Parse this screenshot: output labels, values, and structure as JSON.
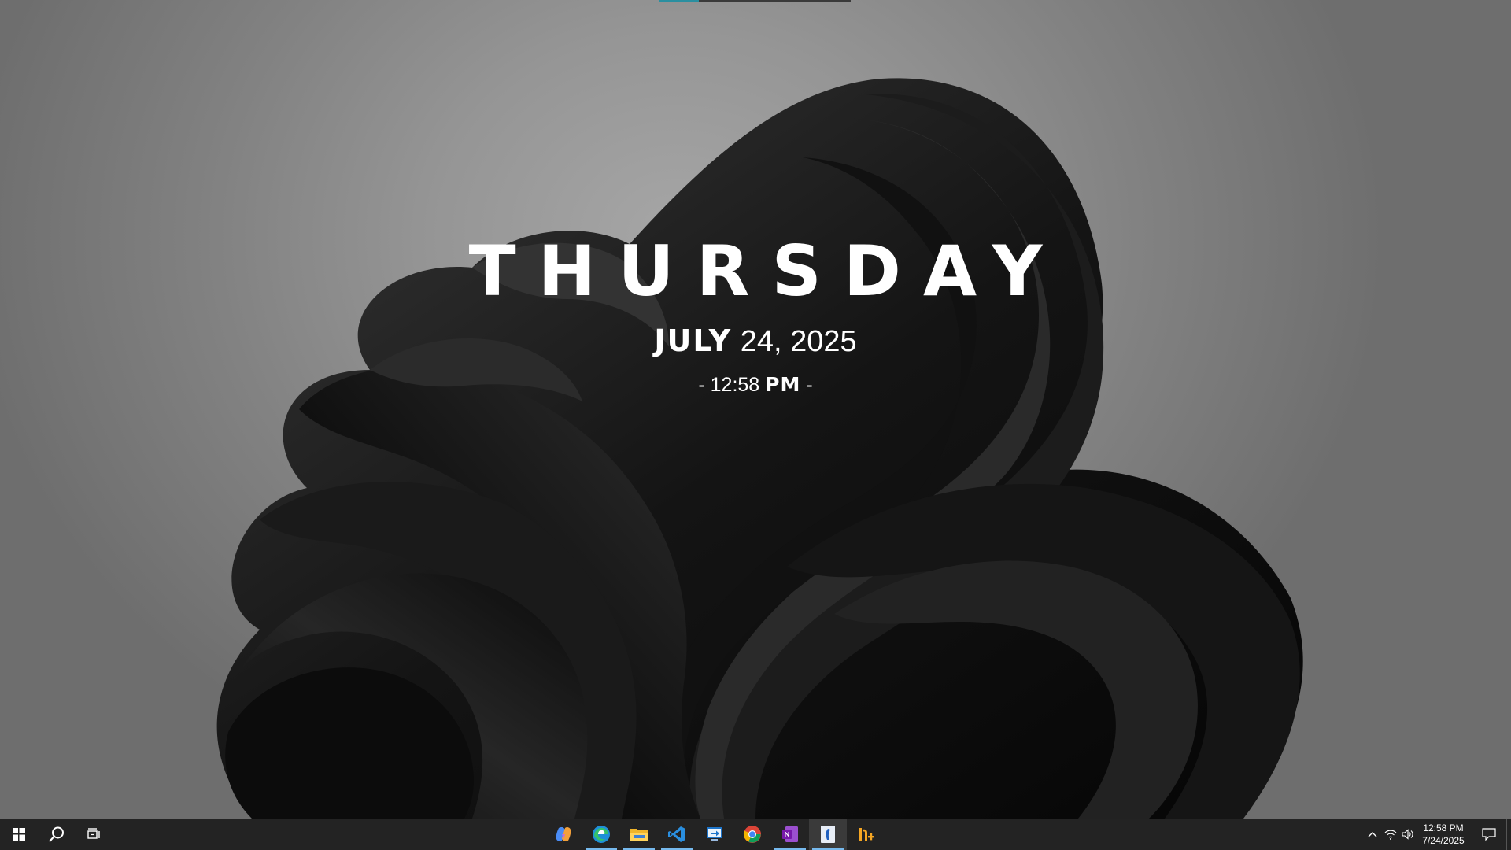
{
  "desktop": {
    "widget": {
      "day": "THURSDAY",
      "month": "JULY",
      "date_rest": "24, 2025",
      "time_prefix": "- 12:58",
      "ampm": "PM",
      "time_suffix": "-"
    }
  },
  "taskbar": {
    "start": {
      "icon": "windows-logo-icon"
    },
    "search": {
      "icon": "search-icon"
    },
    "task_view": {
      "icon": "task-view-icon"
    },
    "apps": [
      {
        "name": "Microsoft Copilot",
        "icon": "copilot-icon",
        "running": false
      },
      {
        "name": "Microsoft Edge",
        "icon": "edge-icon",
        "running": true
      },
      {
        "name": "File Explorer",
        "icon": "folder-icon",
        "running": true
      },
      {
        "name": "Visual Studio Code",
        "icon": "vscode-icon",
        "running": true
      },
      {
        "name": "Remote Desktop",
        "icon": "remote-desktop-icon",
        "running": false
      },
      {
        "name": "Google Chrome",
        "icon": "chrome-icon",
        "running": false
      },
      {
        "name": "OneNote",
        "icon": "onenote-icon",
        "running": true
      },
      {
        "name": "Active App",
        "icon": "app-window-icon",
        "running": true,
        "active": true
      },
      {
        "name": "Notepad++",
        "icon": "notepad-plus-icon",
        "running": false
      }
    ],
    "tray": {
      "chevron_icon": "chevron-up-icon",
      "network_icon": "wifi-icon",
      "volume_icon": "speaker-icon",
      "time": "12:58 PM",
      "date": "7/24/2025",
      "notifications_icon": "action-center-icon"
    }
  },
  "colors": {
    "taskbar_bg": "#232323",
    "running_indicator": "#76b9ed",
    "widget_text": "#ffffff"
  }
}
